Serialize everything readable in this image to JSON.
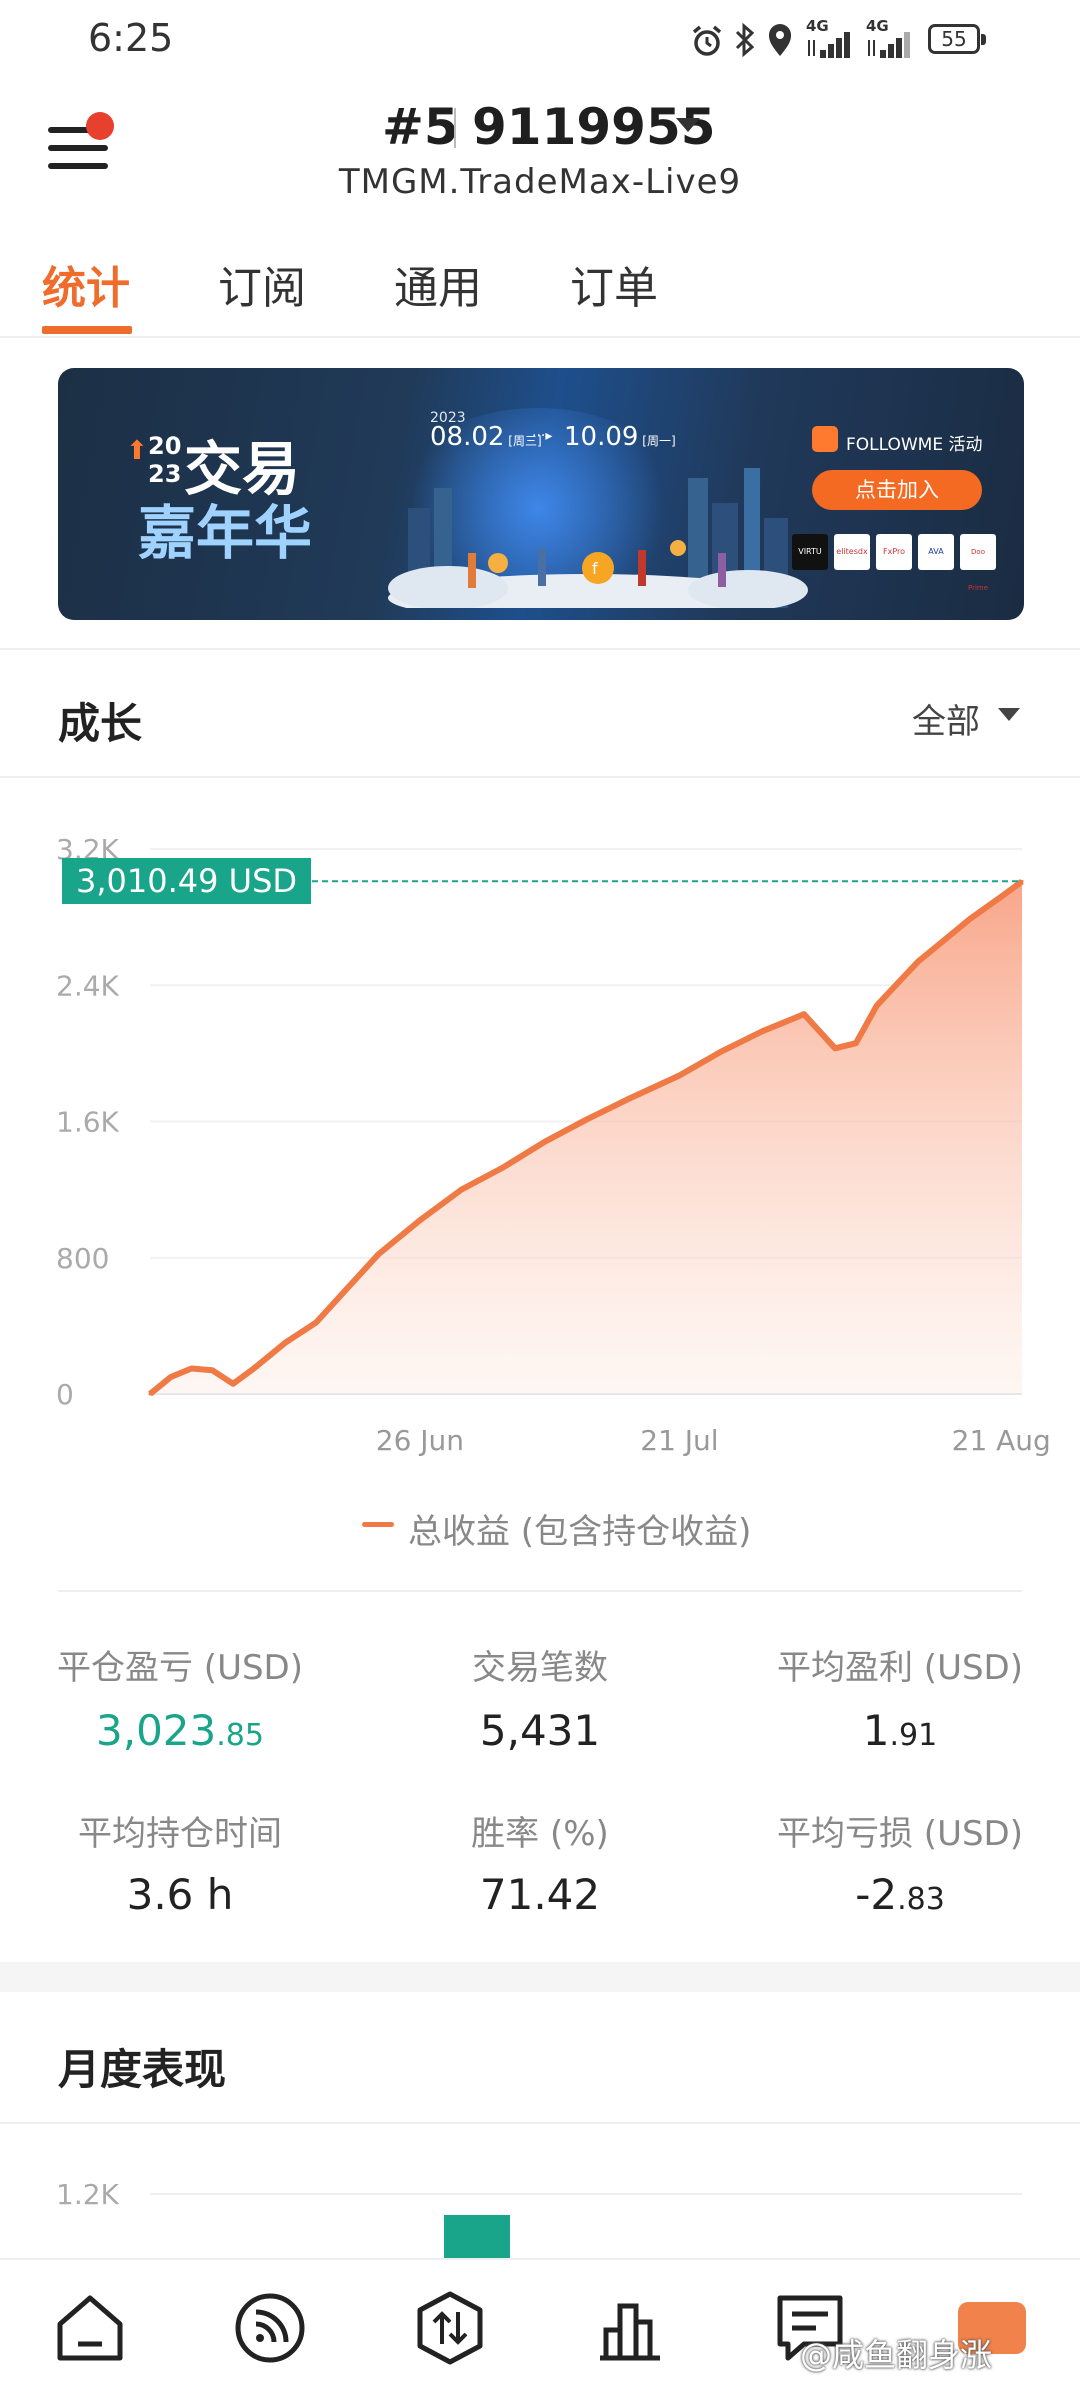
{
  "status_bar": {
    "time": "6:25",
    "net1": "4G",
    "net2": "4G",
    "battery": "55",
    "icons": [
      "alarm-icon",
      "bluetooth-icon",
      "location-icon",
      "signal-icon",
      "signal-icon",
      "battery-icon"
    ]
  },
  "header": {
    "rank": "#5",
    "account_number": "9119955",
    "server": "TMGM.TradeMax-Live9"
  },
  "tabs": [
    {
      "label": "统计",
      "active": true
    },
    {
      "label": "订阅",
      "active": false
    },
    {
      "label": "通用",
      "active": false
    },
    {
      "label": "订单",
      "active": false
    }
  ],
  "banner": {
    "year_a": "20",
    "year_b": "23",
    "title_line1": "交易",
    "title_line2": "嘉年华",
    "year_small": "2023",
    "date_start": "08.02",
    "date_start_day": "周三",
    "date_end": "10.09",
    "date_end_day": "周一",
    "logo_text": "FOLLOWME 活动",
    "join_label": "点击加入",
    "sponsors": [
      "VIRTU",
      "elitesdx",
      "FxPro",
      "AVA",
      "Doo Prime"
    ]
  },
  "growth": {
    "title": "成长",
    "filter": "全部",
    "current_value_label": "3,010.49 USD",
    "legend": "总收益 (包含持仓收益)"
  },
  "chart_data": {
    "type": "area",
    "title": "",
    "xlabel": "",
    "ylabel": "",
    "x_ticks": [
      "26 Jun",
      "21 Jul",
      "21 Aug"
    ],
    "y_ticks": [
      "0",
      "800",
      "1.6K",
      "2.4K",
      "3.2K"
    ],
    "ylim": [
      0,
      3200
    ],
    "grid": true,
    "series": [
      {
        "name": "总收益 (包含持仓收益)",
        "color": "#ef7a45",
        "x": [
          "2023-05-31",
          "2023-06-02",
          "2023-06-04",
          "2023-06-06",
          "2023-06-08",
          "2023-06-10",
          "2023-06-13",
          "2023-06-16",
          "2023-06-19",
          "2023-06-22",
          "2023-06-26",
          "2023-06-30",
          "2023-07-04",
          "2023-07-08",
          "2023-07-12",
          "2023-07-16",
          "2023-07-21",
          "2023-07-25",
          "2023-07-29",
          "2023-08-02",
          "2023-08-05",
          "2023-08-07",
          "2023-08-09",
          "2023-08-11",
          "2023-08-13",
          "2023-08-15",
          "2023-08-18",
          "2023-08-21",
          "2023-08-23"
        ],
        "values": [
          0,
          100,
          150,
          140,
          60,
          150,
          300,
          420,
          620,
          820,
          1020,
          1200,
          1330,
          1480,
          1610,
          1730,
          1870,
          2010,
          2130,
          2230,
          2030,
          2060,
          2280,
          2410,
          2540,
          2640,
          2790,
          2920,
          3010
        ]
      }
    ],
    "current_value": 3010.49
  },
  "stats": [
    {
      "label": "平仓盈亏 (USD)",
      "value_main": "3,023",
      "value_decimal": ".85"
    },
    {
      "label": "交易笔数",
      "value_main": "5,431",
      "value_decimal": ""
    },
    {
      "label": "平均盈利 (USD)",
      "value_main": "1",
      "value_decimal": ".91"
    },
    {
      "label": "平均持仓时间",
      "value_main": "3.6 h",
      "value_decimal": ""
    },
    {
      "label": "胜率 (%)",
      "value_main": "71.42",
      "value_decimal": ""
    },
    {
      "label": "平均亏损 (USD)",
      "value_main": "-2",
      "value_decimal": ".83"
    }
  ],
  "monthly": {
    "title": "月度表现",
    "y_tick_top": "1.2K"
  },
  "bottom_nav": {
    "items": [
      "home-icon",
      "feed-icon",
      "trade-icon",
      "stats-icon",
      "messages-icon"
    ],
    "watermark": "@咸鱼翻身涨"
  }
}
